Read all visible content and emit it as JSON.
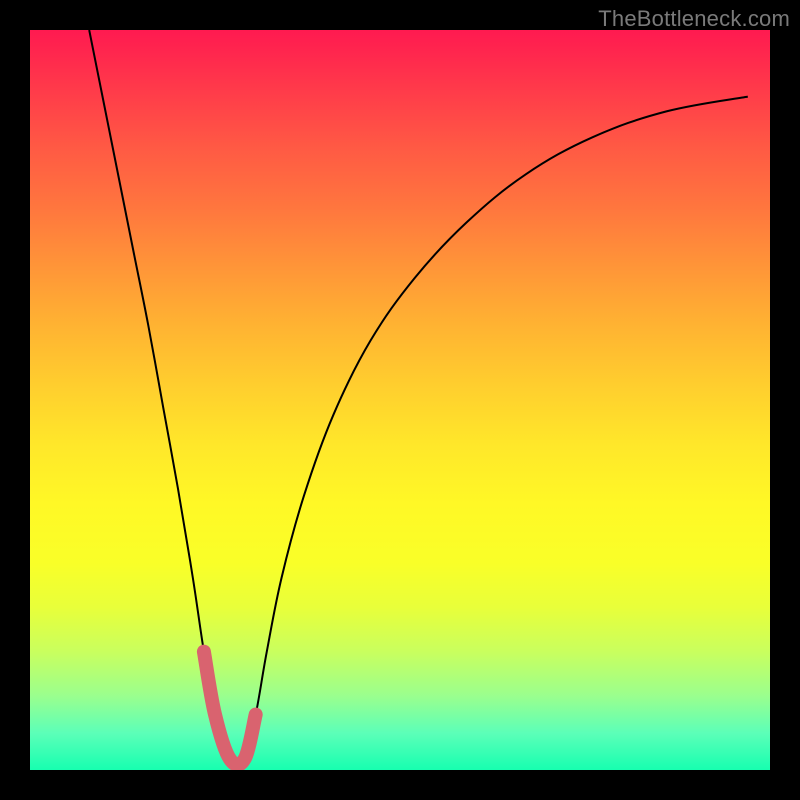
{
  "watermark": "TheBottleneck.com",
  "chart_data": {
    "type": "line",
    "title": "",
    "xlabel": "",
    "ylabel": "",
    "xlim": [
      0,
      100
    ],
    "ylim": [
      0,
      100
    ],
    "description": "Bottleneck-shaped curve: steep fall from top-left, reaching a narrow minimum near x≈27 at the baseline, then rising with a long curved right arm toward the upper-right. Minimum segment is highlighted with a thick pink stroke.",
    "series": [
      {
        "name": "curve",
        "x": [
          8,
          10,
          12,
          14,
          16,
          18,
          20,
          22,
          23.5,
          25,
          27,
          29,
          30.5,
          32,
          34,
          37,
          41,
          46,
          52,
          59,
          67,
          76,
          86,
          97
        ],
        "y": [
          100,
          90,
          80,
          70,
          60,
          49,
          38,
          26,
          16,
          7.5,
          1.5,
          1.5,
          7.5,
          16,
          26,
          37,
          48,
          58,
          66.5,
          74,
          80.5,
          85.5,
          89,
          91
        ],
        "color": "#000000",
        "width": 2
      },
      {
        "name": "highlight",
        "x": [
          23.5,
          25,
          27,
          29,
          30.5
        ],
        "y": [
          16,
          7.5,
          1.5,
          1.5,
          7.5
        ],
        "color": "#d9636f",
        "width": 14
      }
    ]
  }
}
